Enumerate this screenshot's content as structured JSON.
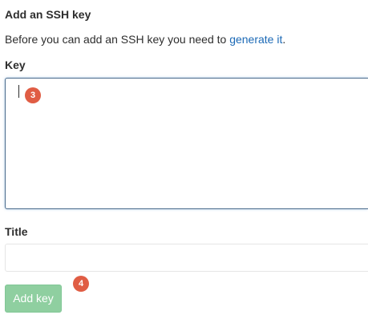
{
  "form": {
    "heading": "Add an SSH key",
    "intro_text": "Before you can add an SSH key you need to ",
    "intro_link": "generate it",
    "intro_suffix": ".",
    "key_label": "Key",
    "key_value": "",
    "title_label": "Title",
    "title_value": "",
    "submit_label": "Add key"
  },
  "annotations": {
    "step_a": "3",
    "step_b": "4"
  },
  "colors": {
    "link": "#1b69b6",
    "submit_button": "#8fcfa0",
    "badge": "#e05d44"
  }
}
